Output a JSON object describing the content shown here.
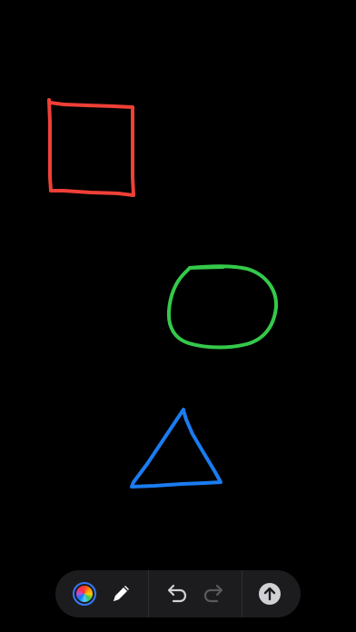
{
  "canvas": {
    "background": "#000000",
    "shapes": [
      {
        "name": "square-stroke",
        "kind": "square",
        "color": "#ef4037"
      },
      {
        "name": "circle-stroke",
        "kind": "circle",
        "color": "#34c94a"
      },
      {
        "name": "triangle-stroke",
        "kind": "triangle",
        "color": "#1a7cf0"
      }
    ]
  },
  "toolbar": {
    "background": "#1c1c1e",
    "color_picker": {
      "icon": "color-wheel-icon",
      "ring_color": "#3478f6"
    },
    "pen": {
      "icon": "pencil-icon",
      "color": "#ffffff"
    },
    "undo": {
      "icon": "undo-icon",
      "color": "#d0d0d5",
      "enabled": true
    },
    "redo": {
      "icon": "redo-icon",
      "color": "#5a5a5e",
      "enabled": false
    },
    "send": {
      "icon": "arrow-up-circle-icon",
      "color": "#d0d0d5"
    }
  }
}
